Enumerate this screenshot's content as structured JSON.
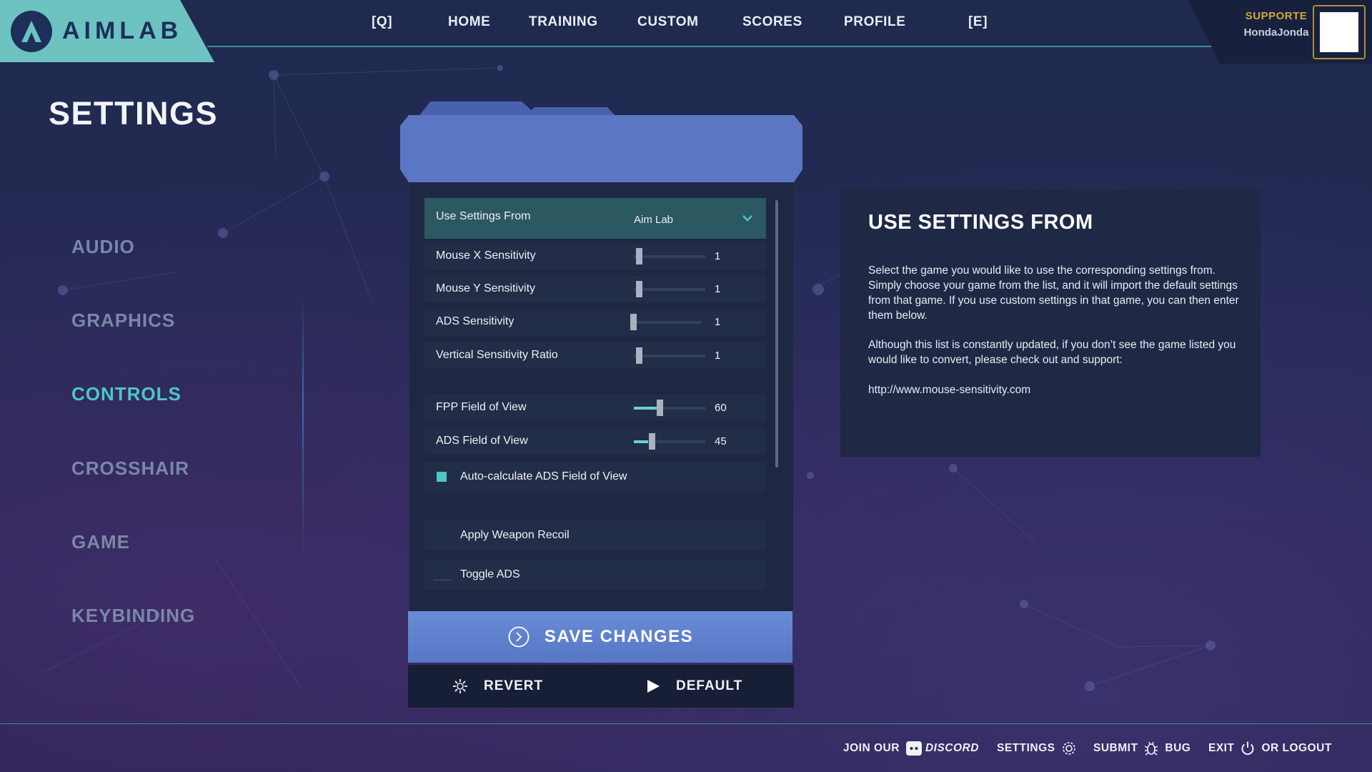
{
  "app": {
    "logo_text": "AIMLAB"
  },
  "nav": {
    "items": [
      {
        "label": "[Q]"
      },
      {
        "label": "HOME"
      },
      {
        "label": "TRAINING"
      },
      {
        "label": "CUSTOM"
      },
      {
        "label": "SCORES"
      },
      {
        "label": "PROFILE"
      },
      {
        "label": "[E]"
      }
    ]
  },
  "user": {
    "badge": "SUPPORTE",
    "name": "HondaJonda"
  },
  "settings": {
    "title": "SETTINGS",
    "categories": [
      {
        "label": "AUDIO",
        "active": false
      },
      {
        "label": "GRAPHICS",
        "active": false
      },
      {
        "label": "CONTROLS",
        "active": true
      },
      {
        "label": "CROSSHAIR",
        "active": false
      },
      {
        "label": "GAME",
        "active": false
      },
      {
        "label": "KEYBINDING",
        "active": false
      }
    ]
  },
  "controls": {
    "use_settings_from": {
      "label": "Use Settings From",
      "value": "Aim Lab"
    },
    "rows": [
      {
        "label": "Mouse X Sensitivity",
        "value": "1"
      },
      {
        "label": "Mouse Y Sensitivity",
        "value": "1"
      },
      {
        "label": "ADS Sensitivity",
        "value": "1"
      },
      {
        "label": "Vertical Sensitivity Ratio",
        "value": "1"
      },
      {
        "label": "FPP Field of View",
        "value": "60"
      },
      {
        "label": "ADS Field of View",
        "value": "45"
      }
    ],
    "auto_ads": {
      "label": "Auto-calculate ADS Field of View",
      "checked": true
    },
    "weapon_recoil": {
      "label": "Apply Weapon Recoil",
      "checked": false
    },
    "toggle_ads": {
      "label": "Toggle ADS",
      "checked": false
    },
    "save_label": "SAVE CHANGES",
    "revert_label": "REVERT",
    "default_label": "DEFAULT"
  },
  "info": {
    "title": "USE SETTINGS FROM",
    "paragraph1": "Select the game you would like to use the corresponding  settings from. Simply choose your game from the list, and it will import the default settings from that game. If you use custom settings in that game, you can then enter them below.",
    "paragraph2": "Although this list is constantly updated, if you don’t see the game listed you would like to convert, please check out and support:",
    "link": "http://www.mouse-sensitivity.com"
  },
  "footer": {
    "join": "JOIN OUR",
    "discord": "DISCORD",
    "settings": "SETTINGS",
    "submit": "SUBMIT",
    "bug": "BUG",
    "exit": "EXIT",
    "logout": "OR LOGOUT"
  },
  "colors": {
    "accent": "#4dc6c6",
    "brand": "#6cc3c0",
    "save_button": "#5a7bc8",
    "supporter": "#d4a63a"
  }
}
